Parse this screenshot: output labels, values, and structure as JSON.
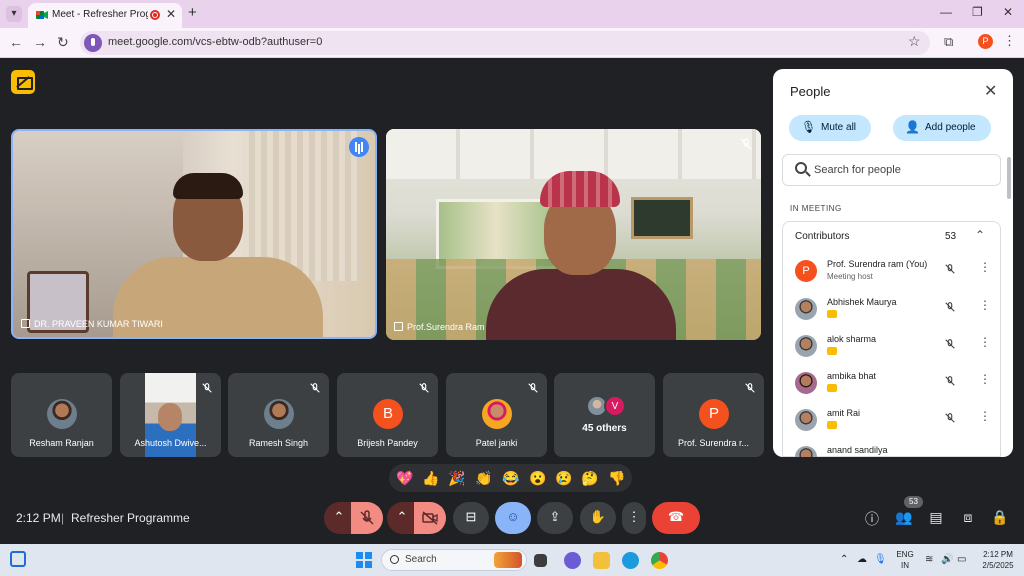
{
  "browser": {
    "tab_title": "Meet - Refresher Programm",
    "url": "meet.google.com/vcs-ebtw-odb?authuser=0",
    "profile_initial": "P"
  },
  "stage": {
    "main_tiles": [
      {
        "name": "DR. PRAVEEN KUMAR TIWARI",
        "speaking": true
      },
      {
        "name": "Prof.Surendra Ram",
        "muted": true
      }
    ],
    "small_tiles": [
      {
        "name": "Resham Ranjan",
        "type": "photo"
      },
      {
        "name": "Ashutosh Dwive...",
        "type": "video",
        "muted": true
      },
      {
        "name": "Ramesh Singh",
        "type": "photo",
        "muted": true
      },
      {
        "name": "Brijesh Pandey",
        "type": "letter",
        "initial": "B",
        "color": "#f4511e",
        "muted": true
      },
      {
        "name": "Patel janki",
        "type": "photo",
        "muted": true
      },
      {
        "name": "45 others",
        "type": "stack",
        "initial": "V"
      },
      {
        "name": "Prof. Surendra r...",
        "type": "letter",
        "initial": "P",
        "color": "#f4511e",
        "muted": true
      }
    ],
    "reactions": [
      "💖",
      "👍",
      "🎉",
      "👏",
      "😂",
      "😮",
      "😢",
      "🤔",
      "👎"
    ]
  },
  "bottom_bar": {
    "time": "2:12 PM",
    "separator": "|",
    "meeting_title": "Refresher Programme",
    "people_count": "53"
  },
  "people_panel": {
    "title": "People",
    "mute_all": "Mute all",
    "add_people": "Add people",
    "search_placeholder": "Search for people",
    "section_label": "IN MEETING",
    "group_label": "Contributors",
    "group_count": "53",
    "participants": [
      {
        "name": "Prof. Surendra ram (You)",
        "role": "Meeting host",
        "avatar": "letter",
        "initial": "P"
      },
      {
        "name": "Abhishek Maurya",
        "role": "",
        "avatar": "photo"
      },
      {
        "name": "alok sharma",
        "role": "",
        "avatar": "photo"
      },
      {
        "name": "ambika bhat",
        "role": "",
        "avatar": "photo"
      },
      {
        "name": "amit Rai",
        "role": "",
        "avatar": "photo"
      },
      {
        "name": "anand sandilya",
        "role": "",
        "avatar": "photo"
      }
    ]
  },
  "taskbar": {
    "search_label": "Search",
    "lang_top": "ENG",
    "lang_bottom": "IN",
    "time": "2:12 PM",
    "date": "2/5/2025"
  },
  "colors": {
    "accent_blue": "#8ab4f8",
    "end_call": "#ea4335",
    "meet_bg": "#202124"
  }
}
